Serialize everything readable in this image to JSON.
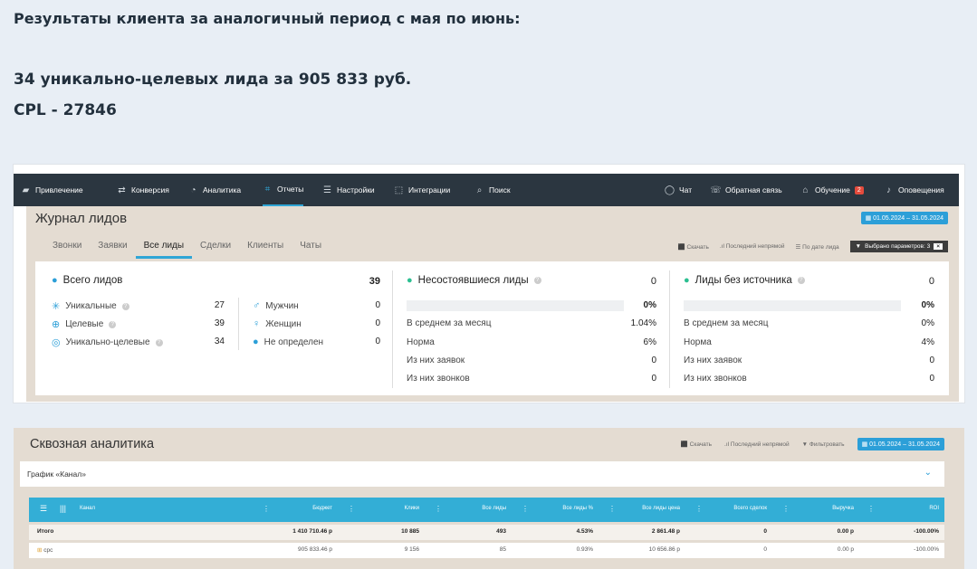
{
  "intro": {
    "line1": "Результаты клиента за аналогичный период с мая по июнь:",
    "line2": "34 уникально-целевых лида за 905 833 руб.",
    "line3": "CPL - 27846"
  },
  "topnav": {
    "items": [
      {
        "label": "Привлечение",
        "icon": "megaphone-icon"
      },
      {
        "label": "Конверсия",
        "icon": "conversion-icon"
      },
      {
        "label": "Аналитика",
        "icon": "analytics-icon"
      },
      {
        "label": "Отчеты",
        "icon": "reports-icon"
      },
      {
        "label": "Настройки",
        "icon": "settings-icon"
      },
      {
        "label": "Интеграции",
        "icon": "integrations-icon"
      },
      {
        "label": "Поиск",
        "icon": "search-icon"
      }
    ],
    "right": [
      {
        "label": "Чат",
        "icon": "chat-icon"
      },
      {
        "label": "Обратная связь",
        "icon": "feedback-icon"
      },
      {
        "label": "Обучение",
        "icon": "education-icon",
        "badge": "2"
      },
      {
        "label": "Оповещения",
        "icon": "bell-icon"
      }
    ]
  },
  "journal": {
    "title": "Журнал лидов",
    "date_range": "01.05.2024 – 31.05.2024",
    "tabs": [
      "Звонки",
      "Заявки",
      "Все лиды",
      "Сделки",
      "Клиенты",
      "Чаты"
    ],
    "active_tab": "Все лиды",
    "tools": {
      "download": "Скачать",
      "attribution": "Последний непрямой",
      "sort": "По дате лида",
      "selected": "Выбрано параметров: 3",
      "close": "×"
    }
  },
  "stats": {
    "total": {
      "label": "Всего лидов",
      "value": "39"
    },
    "left": [
      {
        "label": "Уникальные",
        "value": "27"
      },
      {
        "label": "Целевые",
        "value": "39"
      },
      {
        "label": "Уникально-целевые",
        "value": "34"
      }
    ],
    "gender": [
      {
        "label": "Мужчин",
        "value": "0"
      },
      {
        "label": "Женщин",
        "value": "0"
      },
      {
        "label": "Не определен",
        "value": "0"
      }
    ],
    "failed": {
      "label": "Несостоявшиеся лиды",
      "value": "0",
      "percent": "0%",
      "rows": [
        {
          "label": "В среднем за месяц",
          "value": "1.04%"
        },
        {
          "label": "Норма",
          "value": "6%"
        },
        {
          "label": "Из них заявок",
          "value": "0"
        },
        {
          "label": "Из них звонков",
          "value": "0"
        }
      ]
    },
    "no_source": {
      "label": "Лиды без источника",
      "value": "0",
      "percent": "0%",
      "rows": [
        {
          "label": "В среднем за месяц",
          "value": "0%"
        },
        {
          "label": "Норма",
          "value": "4%"
        },
        {
          "label": "Из них заявок",
          "value": "0"
        },
        {
          "label": "Из них звонков",
          "value": "0"
        }
      ]
    }
  },
  "analytics": {
    "title": "Сквозная аналитика",
    "tools": {
      "download": "Скачать",
      "attribution": "Последний непрямой",
      "filter": "Фильтровать",
      "date_range": "01.05.2024 – 31.05.2024"
    },
    "graph_label": "График «Канал»",
    "columns": [
      "Канал",
      "Бюджет",
      "Клики",
      "Все лиды",
      "Все лиды %",
      "Все лиды цена",
      "Всего сделок",
      "Выручка",
      "ROI"
    ],
    "rows": [
      {
        "name": "Итого",
        "cells": [
          "1 410 710.46 р",
          "10 885",
          "493",
          "4.53%",
          "2 861.48 р",
          "0",
          "0.00 р",
          "-100.00%"
        ]
      },
      {
        "name": "cpc",
        "cells": [
          "905 833.46 р",
          "9 156",
          "85",
          "0.93%",
          "10 656.86 р",
          "0",
          "0.00 р",
          "-100.00%"
        ]
      }
    ]
  }
}
